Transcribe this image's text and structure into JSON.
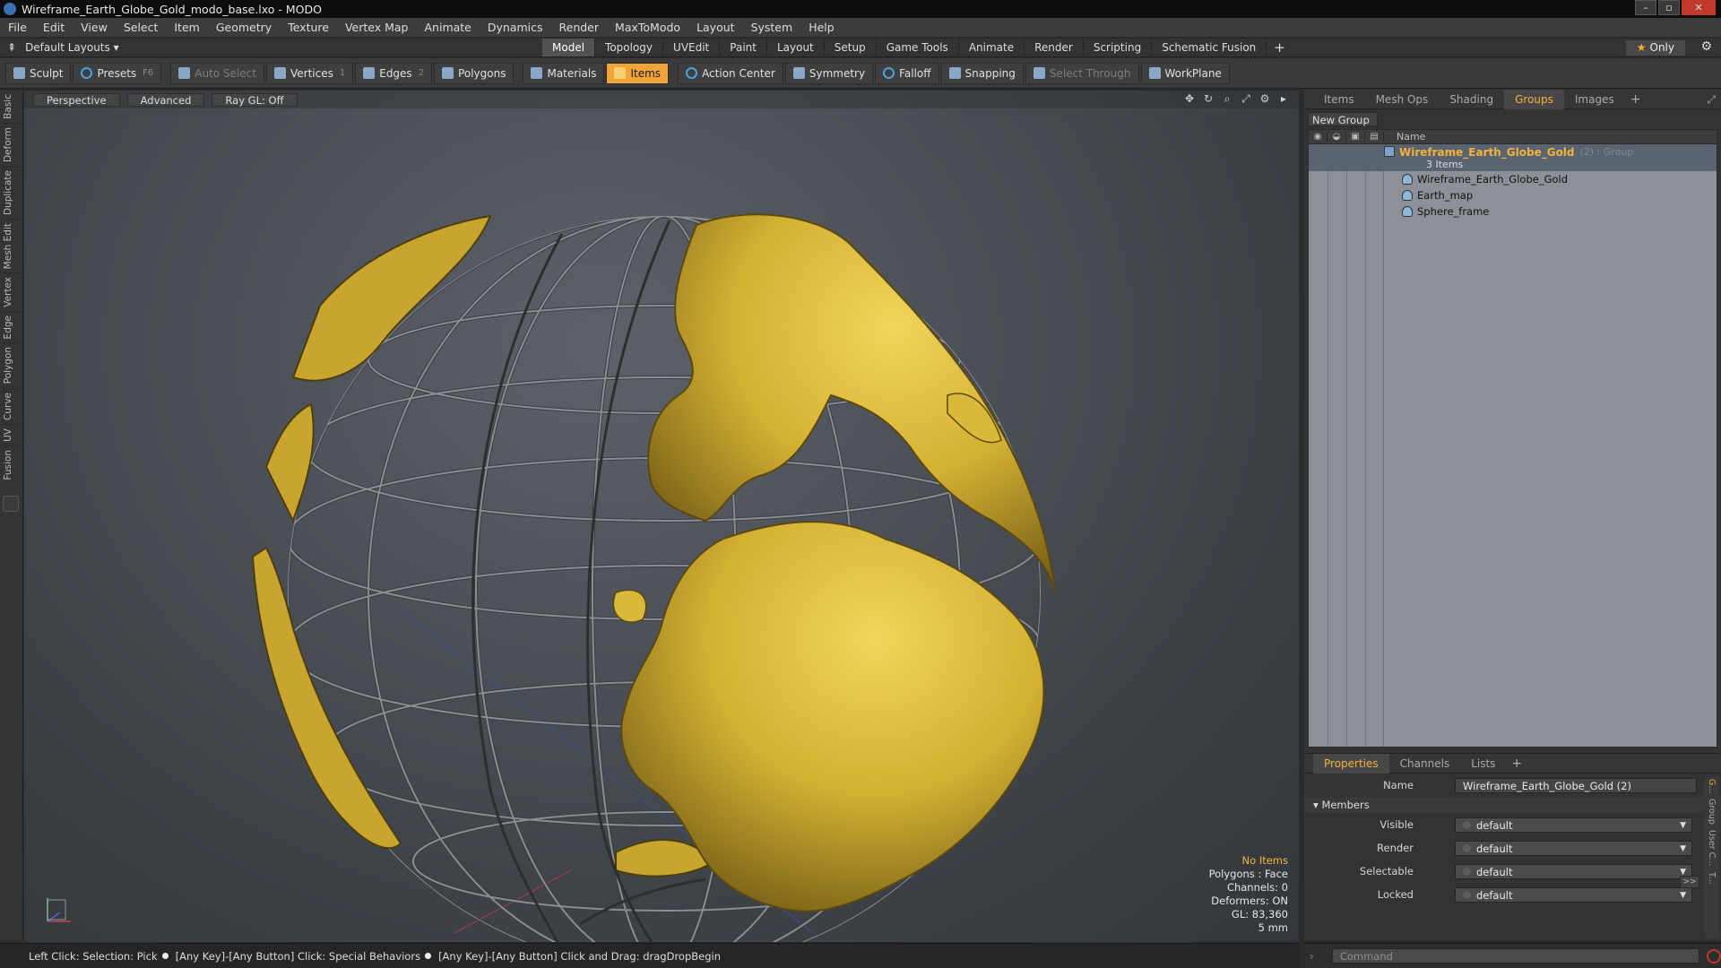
{
  "title": "Wireframe_Earth_Globe_Gold_modo_base.lxo - MODO",
  "window_buttons": [
    "–",
    "▫",
    "✕"
  ],
  "menu": [
    "File",
    "Edit",
    "View",
    "Select",
    "Item",
    "Geometry",
    "Texture",
    "Vertex Map",
    "Animate",
    "Dynamics",
    "Render",
    "MaxToModo",
    "Layout",
    "System",
    "Help"
  ],
  "layouts_label": "Default Layouts ▾",
  "tabs": [
    "Model",
    "Topology",
    "UVEdit",
    "Paint",
    "Layout",
    "Setup",
    "Game Tools",
    "Animate",
    "Render",
    "Scripting",
    "Schematic Fusion"
  ],
  "tab_add": "+",
  "only_label": "Only",
  "toolbar": {
    "sculpt": "Sculpt",
    "presets": "Presets",
    "presets_key": "F6",
    "auto_select": "Auto Select",
    "vertices": "Vertices",
    "vertices_key": "1",
    "edges": "Edges",
    "edges_key": "2",
    "polygons": "Polygons",
    "materials": "Materials",
    "items": "Items",
    "action_center": "Action Center",
    "symmetry": "Symmetry",
    "falloff": "Falloff",
    "snapping": "Snapping",
    "select_through": "Select Through",
    "workplane": "WorkPlane"
  },
  "left_tabs": [
    "Basic",
    "Deform",
    "Duplicate",
    "Mesh Edit",
    "Vertex",
    "Edge",
    "Polygon",
    "Curve",
    "UV",
    "Fusion"
  ],
  "viewport": {
    "perspective": "Perspective",
    "advanced": "Advanced",
    "raygl": "Ray GL: Off",
    "info": {
      "items": "No Items",
      "polygons": "Polygons : Face",
      "channels": "Channels: 0",
      "deformers": "Deformers: ON",
      "gl": "GL: 83,360",
      "unit": "5 mm"
    }
  },
  "status": {
    "part1": "Left Click: Selection: Pick",
    "part2": "[Any Key]-[Any Button] Click: Special Behaviors",
    "part3": "[Any Key]-[Any Button] Click and Drag: dragDropBegin"
  },
  "right_tabs": [
    "Items",
    "Mesh Ops",
    "Shading",
    "Groups",
    "Images"
  ],
  "right_tab_add": "+",
  "new_group": "New Group",
  "tree": {
    "name_header": "Name",
    "group_name": "Wireframe_Earth_Globe_Gold",
    "group_suffix": "(2) : Group",
    "group_count": "3 Items",
    "children": [
      "Wireframe_Earth_Globe_Gold",
      "Earth_map",
      "Sphere_frame"
    ]
  },
  "props_tabs": [
    "Properties",
    "Channels",
    "Lists"
  ],
  "props_tab_add": "+",
  "props": {
    "name_label": "Name",
    "name_value": "Wireframe_Earth_Globe_Gold (2)",
    "members": "Members",
    "visible_label": "Visible",
    "render_label": "Render",
    "selectable_label": "Selectable",
    "locked_label": "Locked",
    "default_value": "default",
    "expand": ">>"
  },
  "side_tabs": [
    "G...",
    "Group",
    "User C...",
    "T..."
  ],
  "command_placeholder": "Command",
  "colors": {
    "accent": "#f4b23a",
    "gold": "#d9b634",
    "viewport_bg": "#4a5055"
  }
}
